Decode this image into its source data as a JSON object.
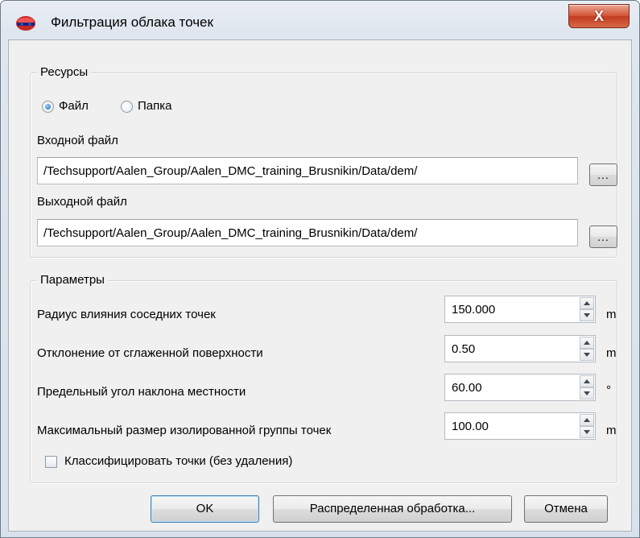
{
  "window": {
    "title": "Фильтрация облака точек",
    "close_glyph": "X"
  },
  "resources": {
    "title": "Ресурсы",
    "source_options": [
      {
        "label": "Файл",
        "checked": true
      },
      {
        "label": "Папка",
        "checked": false
      }
    ],
    "input_label": "Входной файл",
    "input_value": "/Techsupport/Aalen_Group/Aalen_DMC_training_Brusnikin/Data/dem/",
    "output_label": "Выходной файл",
    "output_value": "/Techsupport/Aalen_Group/Aalen_DMC_training_Brusnikin/Data/dem/",
    "browse_label": "..."
  },
  "parameters": {
    "title": "Параметры",
    "rows": [
      {
        "label": "Радиус влияния соседних точек",
        "value": "150.000",
        "unit": "m"
      },
      {
        "label": "Отклонение от сглаженной поверхности",
        "value": "0.50",
        "unit": "m"
      },
      {
        "label": "Предельный угол наклона местности",
        "value": "60.00",
        "unit": "°"
      },
      {
        "label": "Максимальный размер изолированной группы точек",
        "value": "100.00",
        "unit": "m"
      }
    ],
    "classify_label": "Классифицировать точки (без удаления)",
    "classify_checked": false
  },
  "buttons": {
    "ok": "OK",
    "distributed": "Распределенная обработка...",
    "cancel": "Отмена"
  },
  "colors": {
    "accent_focus": "#3c7fb1",
    "close_button": "#c33b1d",
    "dialog_bg": "#f0f0f0"
  },
  "icons": {
    "app": "point-cloud-filter-icon",
    "close": "close-icon"
  }
}
